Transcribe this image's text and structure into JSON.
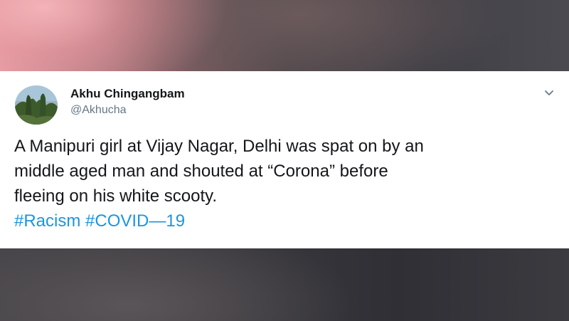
{
  "tweet": {
    "author_name": "Akhu Chingangbam",
    "author_handle": "@Akhucha",
    "text_lines": [
      "A Manipuri girl at Vijay Nagar, Delhi was spat on by an",
      "middle aged man and shouted at “Corona” before",
      "fleeing on his white scooty."
    ],
    "hashtags": [
      "#Racism",
      "#COVID—19"
    ],
    "menu_icon": "chevron-down-icon",
    "avatar_icon": "avatar"
  },
  "colors": {
    "card_background": "#ffffff",
    "name_text": "#14171a",
    "handle_text": "#657786",
    "hashtag_link": "#1b95e0"
  }
}
